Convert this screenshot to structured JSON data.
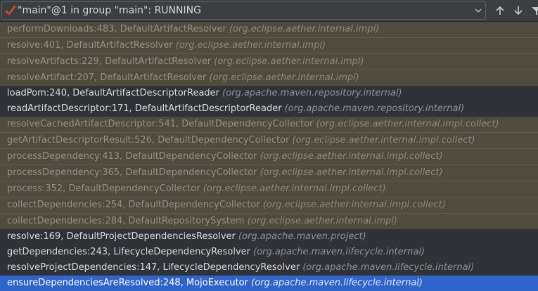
{
  "thread_selector": {
    "label": "\"main\"@1 in group \"main\": RUNNING",
    "status_icon": "check-icon",
    "dropdown_icon": "chevron-down-icon"
  },
  "nav": {
    "up_icon": "arrow-up-icon",
    "down_icon": "arrow-down-icon",
    "filter_icon": "filter-icon"
  },
  "colors": {
    "library_frame_bg": "#4f4b3d",
    "app_frame_bg": "#2f3237",
    "selected_frame_bg": "#2f65ca",
    "check_icon": "#e0402e"
  },
  "frames": [
    {
      "method": "performDownloads:483, DefaultArtifactResolver",
      "pkg": "(org.eclipse.aether.internal.impl)",
      "kind": "lib"
    },
    {
      "method": "resolve:401, DefaultArtifactResolver",
      "pkg": "(org.eclipse.aether.internal.impl)",
      "kind": "lib"
    },
    {
      "method": "resolveArtifacts:229, DefaultArtifactResolver",
      "pkg": "(org.eclipse.aether.internal.impl)",
      "kind": "lib"
    },
    {
      "method": "resolveArtifact:207, DefaultArtifactResolver",
      "pkg": "(org.eclipse.aether.internal.impl)",
      "kind": "lib"
    },
    {
      "method": "loadPom:240, DefaultArtifactDescriptorReader",
      "pkg": "(org.apache.maven.repository.internal)",
      "kind": "app"
    },
    {
      "method": "readArtifactDescriptor:171, DefaultArtifactDescriptorReader",
      "pkg": "(org.apache.maven.repository.internal)",
      "kind": "app"
    },
    {
      "method": "resolveCachedArtifactDescriptor:541, DefaultDependencyCollector",
      "pkg": "(org.eclipse.aether.internal.impl.collect)",
      "kind": "lib"
    },
    {
      "method": "getArtifactDescriptorResult:526, DefaultDependencyCollector",
      "pkg": "(org.eclipse.aether.internal.impl.collect)",
      "kind": "lib"
    },
    {
      "method": "processDependency:413, DefaultDependencyCollector",
      "pkg": "(org.eclipse.aether.internal.impl.collect)",
      "kind": "lib"
    },
    {
      "method": "processDependency:365, DefaultDependencyCollector",
      "pkg": "(org.eclipse.aether.internal.impl.collect)",
      "kind": "lib"
    },
    {
      "method": "process:352, DefaultDependencyCollector",
      "pkg": "(org.eclipse.aether.internal.impl.collect)",
      "kind": "lib"
    },
    {
      "method": "collectDependencies:254, DefaultDependencyCollector",
      "pkg": "(org.eclipse.aether.internal.impl.collect)",
      "kind": "lib"
    },
    {
      "method": "collectDependencies:284, DefaultRepositorySystem",
      "pkg": "(org.eclipse.aether.internal.impl)",
      "kind": "lib"
    },
    {
      "method": "resolve:169, DefaultProjectDependenciesResolver",
      "pkg": "(org.apache.maven.project)",
      "kind": "app"
    },
    {
      "method": "getDependencies:243, LifecycleDependencyResolver",
      "pkg": "(org.apache.maven.lifecycle.internal)",
      "kind": "app"
    },
    {
      "method": "resolveProjectDependencies:147, LifecycleDependencyResolver",
      "pkg": "(org.apache.maven.lifecycle.internal)",
      "kind": "app"
    },
    {
      "method": "ensureDependenciesAreResolved:248, MojoExecutor",
      "pkg": "(org.apache.maven.lifecycle.internal)",
      "kind": "sel"
    }
  ]
}
